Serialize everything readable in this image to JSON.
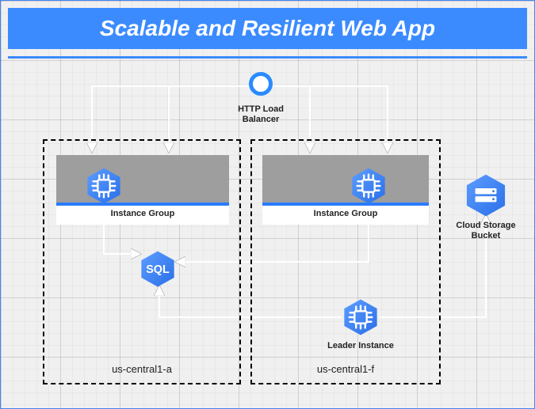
{
  "title": "Scalable and Resilient Web App",
  "load_balancer": {
    "label": "HTTP Load Balancer"
  },
  "zone_a": {
    "name": "us-central1-a",
    "instance_group": {
      "label": "Instance Group"
    },
    "sql": {
      "label": "SQL"
    }
  },
  "zone_f": {
    "name": "us-central1-f",
    "instance_group": {
      "label": "Instance Group"
    },
    "leader": {
      "label": "Leader Instance"
    }
  },
  "storage": {
    "label": "Cloud Storage Bucket"
  },
  "colors": {
    "accent": "#3b8bff",
    "hex": "#4285f4"
  }
}
